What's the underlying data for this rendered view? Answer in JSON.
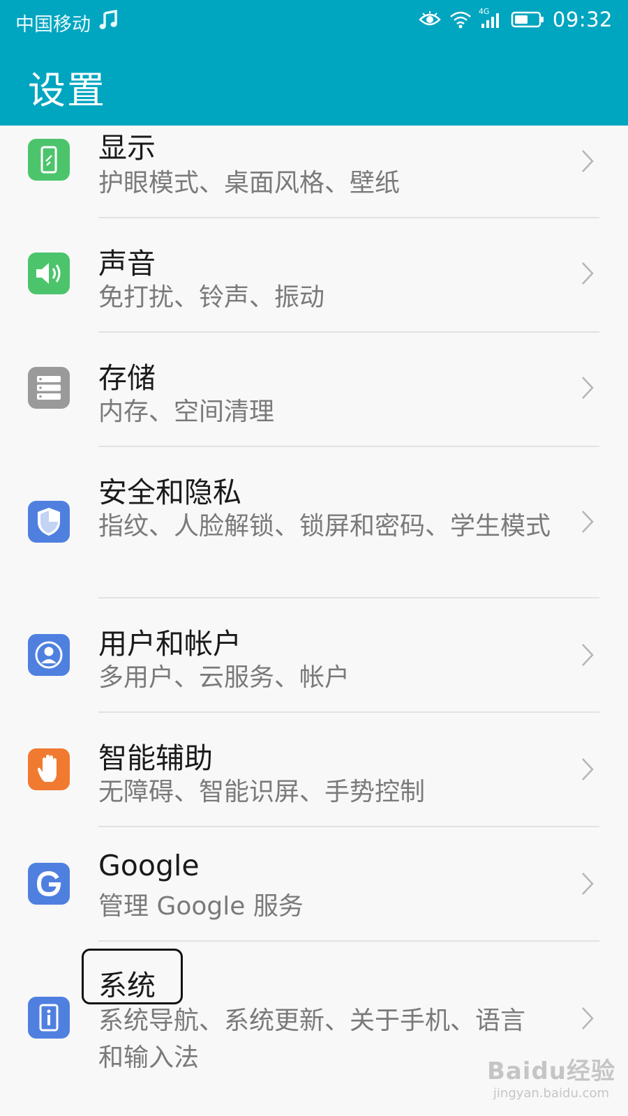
{
  "status_bar": {
    "carrier": "中国移动",
    "network": "4G",
    "time": "09:32"
  },
  "header": {
    "title": "设置"
  },
  "settings_items": [
    {
      "title": "显示",
      "subtitle": "护眼模式、桌面风格、壁纸",
      "icon": "display-icon",
      "color": "#4cc46c"
    },
    {
      "title": "声音",
      "subtitle": "免打扰、铃声、振动",
      "icon": "speaker-icon",
      "color": "#4cc46c"
    },
    {
      "title": "存储",
      "subtitle": "内存、空间清理",
      "icon": "storage-icon",
      "color": "#9a9a9a"
    },
    {
      "title": "安全和隐私",
      "subtitle": "指纹、人脸解锁、锁屏和密码、学生模式",
      "icon": "shield-icon",
      "color": "#4f80e0"
    },
    {
      "title": "用户和帐户",
      "subtitle": "多用户、云服务、帐户",
      "icon": "user-icon",
      "color": "#4f80e0"
    },
    {
      "title": "智能辅助",
      "subtitle": "无障碍、智能识屏、手势控制",
      "icon": "hand-icon",
      "color": "#f07a30"
    },
    {
      "title": "Google",
      "subtitle": "管理 Google 服务",
      "icon": "google-icon",
      "color": "#4f80e0"
    },
    {
      "title": "系统",
      "subtitle": "系统导航、系统更新、关于手机、语言和输入法",
      "icon": "system-icon",
      "color": "#4f80e0"
    }
  ],
  "watermark": {
    "logo": "Baidu经验",
    "url": "jingyan.baidu.com"
  }
}
